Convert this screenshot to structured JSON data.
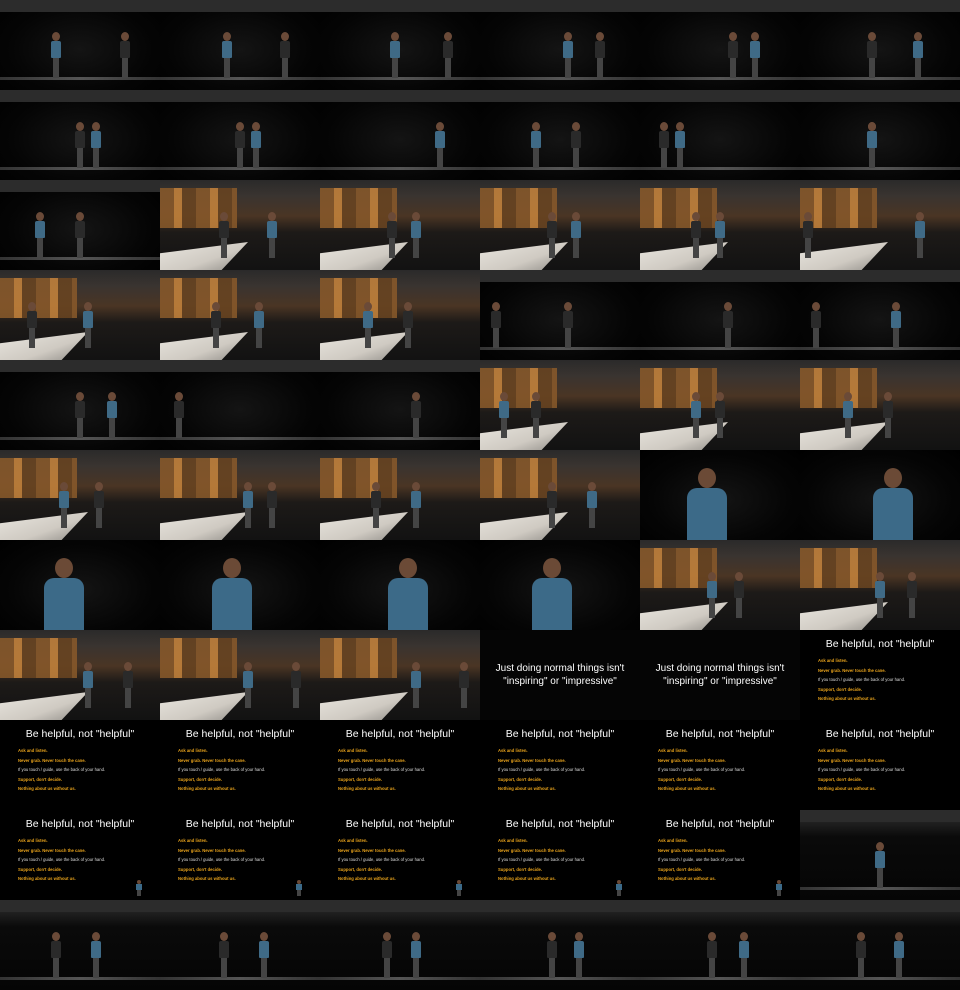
{
  "image": {
    "kind": "video contact sheet",
    "rows": 11,
    "columns": 6,
    "colors": {
      "background": "#000000",
      "shirt_blue": "#3f6a86",
      "wall_wood": "#c8853c",
      "slide_text_white": "#ffffff",
      "slide_text_orange": "#e7a21b"
    }
  },
  "slides": {
    "tips_title": "Be helpful, not \"helpful\"",
    "tips": [
      {
        "text": "Ask and listen.",
        "style": "orange"
      },
      {
        "text": "Never grab. Never touch the cane.",
        "style": "orange"
      },
      {
        "text": "If you touch / guide, use the back of your hand.",
        "style": "white"
      },
      {
        "text": "Support, don't decide.",
        "style": "orange"
      },
      {
        "text": "Nothing about us without us.",
        "style": "orange"
      }
    ],
    "quote_line1": "Just doing normal things isn't",
    "quote_line2": "\"inspiring\" or \"impressive\""
  },
  "tiles": [
    {
      "scene": "dark",
      "people": [
        {
          "x": 0.35,
          "c": "blue"
        },
        {
          "x": 0.78,
          "c": "dark"
        }
      ]
    },
    {
      "scene": "dark",
      "people": [
        {
          "x": 0.42,
          "c": "blue"
        },
        {
          "x": 0.78,
          "c": "dark"
        }
      ]
    },
    {
      "scene": "dark",
      "people": [
        {
          "x": 0.47,
          "c": "blue"
        },
        {
          "x": 0.8,
          "c": "dark"
        }
      ]
    },
    {
      "scene": "dark",
      "people": [
        {
          "x": 0.55,
          "c": "blue"
        },
        {
          "x": 0.75,
          "c": "dark"
        }
      ]
    },
    {
      "scene": "dark",
      "people": [
        {
          "x": 0.58,
          "c": "dark"
        },
        {
          "x": 0.72,
          "c": "blue"
        }
      ]
    },
    {
      "scene": "dark",
      "people": [
        {
          "x": 0.45,
          "c": "dark"
        },
        {
          "x": 0.74,
          "c": "blue"
        }
      ]
    },
    {
      "scene": "dark",
      "people": [
        {
          "x": 0.5,
          "c": "dark"
        },
        {
          "x": 0.6,
          "c": "blue"
        }
      ]
    },
    {
      "scene": "dark",
      "people": [
        {
          "x": 0.6,
          "c": "blue"
        },
        {
          "x": 0.5,
          "c": "dark"
        }
      ]
    },
    {
      "scene": "dark",
      "people": [
        {
          "x": 0.75,
          "c": "blue"
        }
      ]
    },
    {
      "scene": "dark",
      "people": [
        {
          "x": 0.35,
          "c": "blue"
        },
        {
          "x": 0.6,
          "c": "dark"
        }
      ]
    },
    {
      "scene": "dark",
      "people": [
        {
          "x": 0.15,
          "c": "dark"
        },
        {
          "x": 0.25,
          "c": "blue"
        }
      ]
    },
    {
      "scene": "dark",
      "people": [
        {
          "x": 0.45,
          "c": "dark"
        },
        {
          "x": 0.45,
          "c": "blue"
        }
      ]
    },
    {
      "scene": "dark",
      "people": [
        {
          "x": 0.5,
          "c": "dark"
        },
        {
          "x": 0.25,
          "c": "blue"
        }
      ]
    },
    {
      "scene": "lit",
      "people": [
        {
          "x": 0.4,
          "c": "dark"
        },
        {
          "x": 0.7,
          "c": "blue"
        }
      ]
    },
    {
      "scene": "lit",
      "people": [
        {
          "x": 0.45,
          "c": "dark"
        },
        {
          "x": 0.6,
          "c": "blue"
        }
      ]
    },
    {
      "scene": "lit",
      "people": [
        {
          "x": 0.45,
          "c": "dark"
        },
        {
          "x": 0.6,
          "c": "blue"
        }
      ]
    },
    {
      "scene": "lit",
      "people": [
        {
          "x": 0.35,
          "c": "dark"
        },
        {
          "x": 0.5,
          "c": "blue"
        }
      ]
    },
    {
      "scene": "lit",
      "people": [
        {
          "x": 0.05,
          "c": "dark"
        },
        {
          "x": 0.75,
          "c": "blue"
        }
      ]
    },
    {
      "scene": "lit",
      "people": [
        {
          "x": 0.2,
          "c": "dark"
        },
        {
          "x": 0.55,
          "c": "blue"
        }
      ]
    },
    {
      "scene": "lit",
      "people": [
        {
          "x": 0.35,
          "c": "dark"
        },
        {
          "x": 0.62,
          "c": "blue"
        }
      ]
    },
    {
      "scene": "lit",
      "people": [
        {
          "x": 0.55,
          "c": "dark"
        },
        {
          "x": 0.3,
          "c": "blue"
        }
      ]
    },
    {
      "scene": "dark",
      "people": [
        {
          "x": 0.1,
          "c": "dark"
        },
        {
          "x": 0.55,
          "c": "dark"
        }
      ]
    },
    {
      "scene": "dark",
      "people": [
        {
          "x": 0.55,
          "c": "dark"
        }
      ]
    },
    {
      "scene": "dark",
      "people": [
        {
          "x": 0.1,
          "c": "dark"
        },
        {
          "x": 0.6,
          "c": "blue"
        }
      ]
    },
    {
      "scene": "dark",
      "people": [
        {
          "x": 0.5,
          "c": "dark"
        },
        {
          "x": 0.7,
          "c": "blue"
        }
      ]
    },
    {
      "scene": "dark",
      "people": [
        {
          "x": 0.12,
          "c": "dark"
        }
      ]
    },
    {
      "scene": "dark",
      "people": [
        {
          "x": 0.6,
          "c": "dark"
        }
      ]
    },
    {
      "scene": "lit",
      "people": [
        {
          "x": 0.15,
          "c": "blue"
        },
        {
          "x": 0.35,
          "c": "dark"
        }
      ]
    },
    {
      "scene": "lit",
      "people": [
        {
          "x": 0.35,
          "c": "blue"
        },
        {
          "x": 0.5,
          "c": "dark"
        }
      ]
    },
    {
      "scene": "lit",
      "people": [
        {
          "x": 0.3,
          "c": "blue"
        },
        {
          "x": 0.55,
          "c": "dark"
        }
      ]
    },
    {
      "scene": "lit",
      "people": [
        {
          "x": 0.4,
          "c": "blue"
        },
        {
          "x": 0.62,
          "c": "dark"
        }
      ]
    },
    {
      "scene": "lit",
      "people": [
        {
          "x": 0.55,
          "c": "blue"
        },
        {
          "x": 0.7,
          "c": "dark"
        }
      ]
    },
    {
      "scene": "lit",
      "people": [
        {
          "x": 0.6,
          "c": "blue"
        },
        {
          "x": 0.35,
          "c": "dark"
        }
      ]
    },
    {
      "scene": "lit",
      "people": [
        {
          "x": 0.7,
          "c": "blue"
        },
        {
          "x": 0.45,
          "c": "dark"
        }
      ]
    },
    {
      "scene": "portrait",
      "people": [
        {
          "x": 0.42,
          "c": "blue"
        }
      ]
    },
    {
      "scene": "portrait",
      "people": [
        {
          "x": 0.58,
          "c": "blue"
        }
      ]
    },
    {
      "scene": "portrait",
      "people": [
        {
          "x": 0.4,
          "c": "blue"
        }
      ]
    },
    {
      "scene": "portrait",
      "people": [
        {
          "x": 0.45,
          "c": "blue"
        }
      ]
    },
    {
      "scene": "portrait",
      "people": [
        {
          "x": 0.55,
          "c": "blue"
        }
      ]
    },
    {
      "scene": "portrait",
      "people": [
        {
          "x": 0.45,
          "c": "blue"
        }
      ]
    },
    {
      "scene": "lit",
      "people": [
        {
          "x": 0.45,
          "c": "blue"
        },
        {
          "x": 0.62,
          "c": "dark"
        }
      ]
    },
    {
      "scene": "lit",
      "people": [
        {
          "x": 0.5,
          "c": "blue"
        },
        {
          "x": 0.7,
          "c": "dark"
        }
      ]
    },
    {
      "scene": "lit",
      "people": [
        {
          "x": 0.55,
          "c": "blue"
        },
        {
          "x": 0.8,
          "c": "dark"
        }
      ]
    },
    {
      "scene": "lit",
      "people": [
        {
          "x": 0.55,
          "c": "blue"
        },
        {
          "x": 0.85,
          "c": "dark"
        }
      ]
    },
    {
      "scene": "lit",
      "people": [
        {
          "x": 0.6,
          "c": "blue"
        },
        {
          "x": 0.9,
          "c": "dark"
        }
      ]
    },
    {
      "scene": "quote"
    },
    {
      "scene": "quote"
    },
    {
      "scene": "tips"
    },
    {
      "scene": "tips"
    },
    {
      "scene": "tips"
    },
    {
      "scene": "tips"
    },
    {
      "scene": "tips"
    },
    {
      "scene": "tips"
    },
    {
      "scene": "tips"
    },
    {
      "scene": "tips",
      "mini": true
    },
    {
      "scene": "tips",
      "mini": true
    },
    {
      "scene": "tips",
      "mini": true
    },
    {
      "scene": "tips",
      "mini": true
    },
    {
      "scene": "tips",
      "mini": true
    },
    {
      "scene": "wall",
      "people": [
        {
          "x": 0.5,
          "c": "blue"
        }
      ]
    },
    {
      "scene": "wall",
      "people": [
        {
          "x": 0.35,
          "c": "dark"
        },
        {
          "x": 0.6,
          "c": "blue"
        }
      ]
    },
    {
      "scene": "wall",
      "people": [
        {
          "x": 0.4,
          "c": "dark"
        },
        {
          "x": 0.65,
          "c": "blue"
        }
      ]
    },
    {
      "scene": "wall",
      "people": [
        {
          "x": 0.42,
          "c": "dark"
        },
        {
          "x": 0.6,
          "c": "blue"
        }
      ]
    },
    {
      "scene": "wall",
      "people": [
        {
          "x": 0.45,
          "c": "dark"
        },
        {
          "x": 0.62,
          "c": "blue"
        }
      ]
    },
    {
      "scene": "wall",
      "people": [
        {
          "x": 0.45,
          "c": "dark"
        },
        {
          "x": 0.65,
          "c": "blue"
        }
      ]
    },
    {
      "scene": "wall",
      "people": [
        {
          "x": 0.38,
          "c": "dark"
        },
        {
          "x": 0.62,
          "c": "blue"
        }
      ]
    }
  ]
}
